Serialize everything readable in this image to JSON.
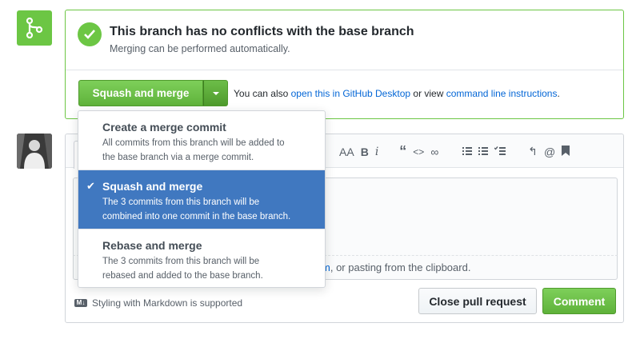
{
  "merge_status": {
    "title": "This branch has no conflicts with the base branch",
    "subtitle": "Merging can be performed automatically.",
    "squash_button_label": "Squash and merge",
    "also_prefix": "You can also",
    "desktop_link": "open this in GitHub Desktop",
    "or_view": "or view",
    "cli_link": "command line instructions",
    "period": "."
  },
  "merge_dropdown": {
    "items": [
      {
        "title": "Create a merge commit",
        "desc_line1": "All commits from this branch will be added to",
        "desc_line2": "the base branch via a merge commit.",
        "selected": false
      },
      {
        "title": "Squash and merge",
        "desc_line1": "The 3 commits from this branch will be",
        "desc_line2": "combined into one commit in the base branch.",
        "selected": true
      },
      {
        "title": "Rebase and merge",
        "desc_line1": "The 3 commits from this branch will be",
        "desc_line2": "rebased and added to the base branch.",
        "selected": false
      }
    ]
  },
  "comment": {
    "toolbar": {
      "header": "AA",
      "bold": "B",
      "italic": "i",
      "quote": "“",
      "code": "<>",
      "link": "∞",
      "reply": "↰",
      "mention": "@"
    },
    "attach_text_link": "m",
    "attach_text_rest": ", or pasting from the clipboard.",
    "markdown_note": "Styling with Markdown is supported",
    "markdown_badge": "M↓",
    "close_label": "Close pull request",
    "comment_label": "Comment"
  },
  "colors": {
    "success_green": "#6cc644",
    "link_blue": "#0366d6",
    "selected_blue": "#4078c0"
  }
}
